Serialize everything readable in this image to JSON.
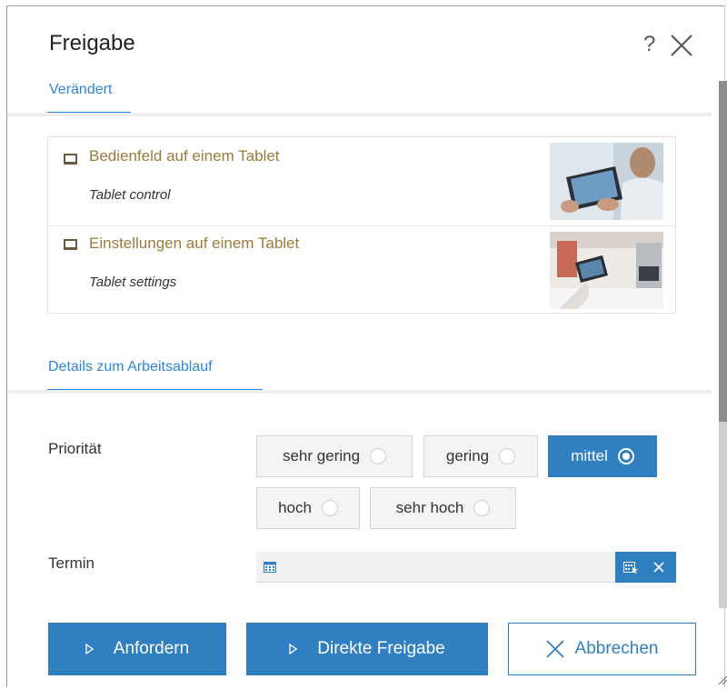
{
  "dialog": {
    "title": "Freigabe",
    "help_label": "?",
    "close_icon": "close-icon"
  },
  "tabs": {
    "changed": "Verändert",
    "workflow": "Details zum Arbeitsablauf"
  },
  "items": [
    {
      "title": "Bedienfeld auf einem Tablet",
      "subtitle": "Tablet control",
      "icon": "tablet-icon"
    },
    {
      "title": "Einstellungen auf einem Tablet",
      "subtitle": "Tablet settings",
      "icon": "tablet-icon"
    }
  ],
  "fields": {
    "priority_label": "Priorität",
    "date_label": "Termin"
  },
  "priority_options": [
    {
      "label": "sehr gering",
      "selected": false
    },
    {
      "label": "gering",
      "selected": false
    },
    {
      "label": "mittel",
      "selected": true
    },
    {
      "label": "hoch",
      "selected": false
    },
    {
      "label": "sehr hoch",
      "selected": false
    }
  ],
  "date": {
    "value": "",
    "icons": [
      "calendar-icon",
      "calendar-picker-icon",
      "clear-icon"
    ]
  },
  "buttons": {
    "request": "Anfordern",
    "direct_release": "Direkte Freigabe",
    "cancel": "Abbrechen"
  },
  "colors": {
    "accent": "#2f7fc1",
    "link": "#2f86d6",
    "item_title": "#9a7b3d"
  }
}
